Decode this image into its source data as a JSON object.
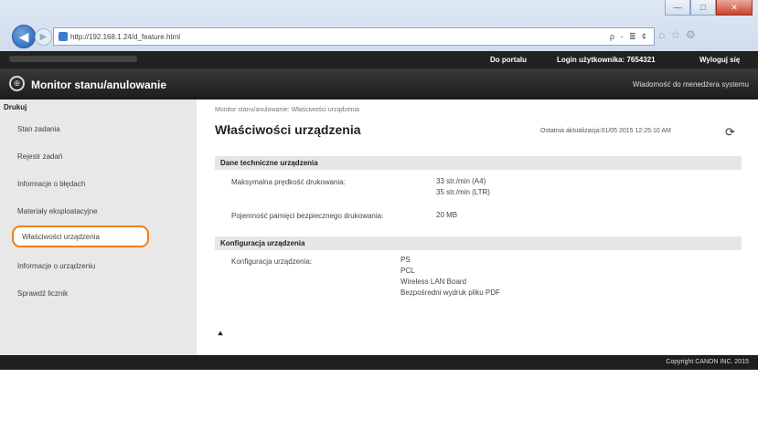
{
  "browser": {
    "url": "http://192.168.1.24/d_feature.html",
    "search_tools": "ρ - ≣ ¢",
    "window_buttons": {
      "minimize": "—",
      "maximize": "□",
      "close": "✕"
    }
  },
  "topbar": {
    "portal_link": "Do portalu",
    "login_label": "Login użytkownika:",
    "login_value": "7654321",
    "logout_link": "Wyloguj się"
  },
  "brandbar": {
    "title": "Monitor stanu/anulowanie",
    "admin_message_link": "Wiadomość do menedżera systemu"
  },
  "sidebar": {
    "heading": "Drukuj",
    "items": [
      {
        "label": "Stan zadania"
      },
      {
        "label": "Rejestr zadań"
      },
      {
        "label": "Informacje o błędach"
      },
      {
        "label": "Materiały eksploatacyjne"
      },
      {
        "label": "Właściwości urządzenia"
      },
      {
        "label": "Informacje o urządzeniu"
      },
      {
        "label": "Sprawdź licznik"
      }
    ]
  },
  "main": {
    "breadcrumb": "Monitor stanu/anulowanie: Właściwości urządzenia",
    "title": "Właściwości urządzenia",
    "last_update": "Ostatnia aktualizacja:01/05 2015 12:25:10 AM",
    "sections": [
      {
        "heading": "Dane techniczne urządzenia",
        "rows": [
          {
            "label": "Maksymalna prędkość drukowania:",
            "values": [
              "33 str./min (A4)",
              "35 str./min (LTR)"
            ]
          },
          {
            "label": "Pojemność pamięci bezpiecznego drukowania:",
            "values": [
              "20 MB"
            ]
          }
        ]
      },
      {
        "heading": "Konfiguracja urządzenia",
        "rows": [
          {
            "label": "Konfiguracja urządzenia:",
            "values": [
              "PS",
              "PCL",
              "Wireless LAN Board",
              "Bezpośredni wydruk pliku PDF"
            ]
          }
        ]
      }
    ],
    "top_link": "⯅"
  },
  "footer": {
    "copyright": "Copyright CANON INC. 2015"
  },
  "colors": {
    "highlight_border": "#f07f1a",
    "topbar_bg": "#222222",
    "sidebar_bg": "#e8e8e8"
  }
}
